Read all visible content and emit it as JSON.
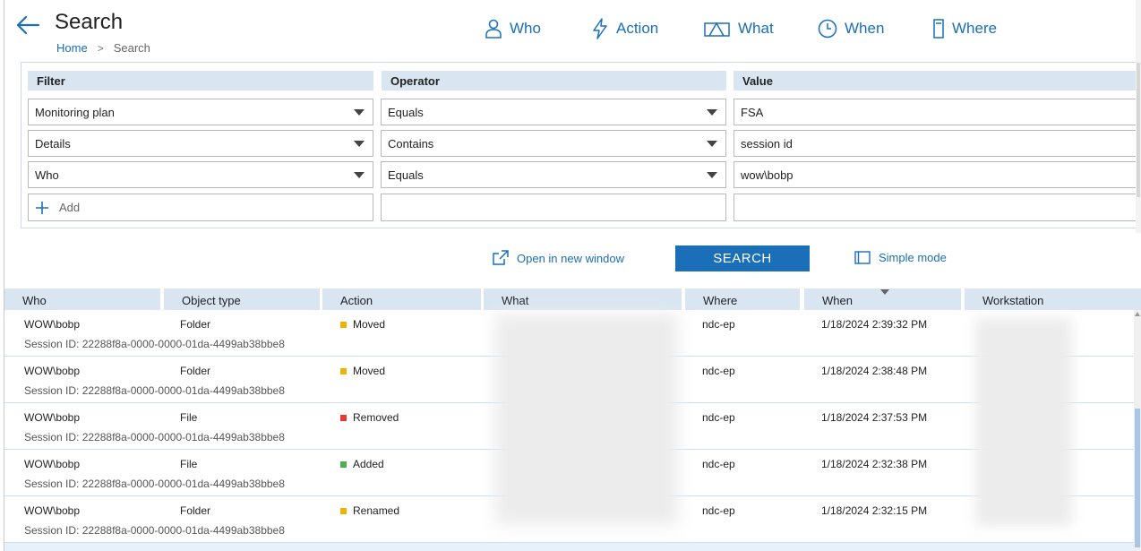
{
  "header": {
    "title": "Search",
    "breadcrumb": {
      "home": "Home",
      "separator": ">",
      "current": "Search"
    }
  },
  "nav": {
    "who": "Who",
    "action": "Action",
    "what": "What",
    "when": "When",
    "where": "Where"
  },
  "filters": {
    "headers": {
      "filter": "Filter",
      "operator": "Operator",
      "value": "Value"
    },
    "rows": [
      {
        "filter": "Monitoring plan",
        "operator": "Equals",
        "value": "FSA"
      },
      {
        "filter": "Details",
        "operator": "Contains",
        "value": "session id"
      },
      {
        "filter": "Who",
        "operator": "Equals",
        "value": "wow\\bobp"
      }
    ],
    "add_label": "Add"
  },
  "actions": {
    "open_new_window": "Open in new window",
    "search": "SEARCH",
    "simple_mode": "Simple mode"
  },
  "results": {
    "columns": [
      "Who",
      "Object type",
      "Action",
      "What",
      "Where",
      "When",
      "Workstation"
    ],
    "sort_column": "When",
    "action_colors": {
      "Moved": "#f0b400",
      "Removed": "#e53935",
      "Added": "#4caf50",
      "Renamed": "#f0b400"
    },
    "rows": [
      {
        "who": "WOW\\bobp",
        "session": "Session ID: 22288f8a-0000-0000-01da-4499ab38bbe8",
        "object_type": "Folder",
        "action": "Moved",
        "action_color": "#f0b400",
        "where": "ndc-ep",
        "when": "1/18/2024 2:39:32 PM"
      },
      {
        "who": "WOW\\bobp",
        "session": "Session ID: 22288f8a-0000-0000-01da-4499ab38bbe8",
        "object_type": "Folder",
        "action": "Moved",
        "action_color": "#f0b400",
        "where": "ndc-ep",
        "when": "1/18/2024 2:38:48 PM"
      },
      {
        "who": "WOW\\bobp",
        "session": "Session ID: 22288f8a-0000-0000-01da-4499ab38bbe8",
        "object_type": "File",
        "action": "Removed",
        "action_color": "#e53935",
        "where": "ndc-ep",
        "when": "1/18/2024 2:37:53 PM"
      },
      {
        "who": "WOW\\bobp",
        "session": "Session ID: 22288f8a-0000-0000-01da-4499ab38bbe8",
        "object_type": "File",
        "action": "Added",
        "action_color": "#4caf50",
        "where": "ndc-ep",
        "when": "1/18/2024 2:32:38 PM"
      },
      {
        "who": "WOW\\bobp",
        "session": "Session ID: 22288f8a-0000-0000-01da-4499ab38bbe8",
        "object_type": "Folder",
        "action": "Renamed",
        "action_color": "#f0b400",
        "where": "ndc-ep",
        "when": "1/18/2024 2:32:15 PM"
      }
    ]
  }
}
